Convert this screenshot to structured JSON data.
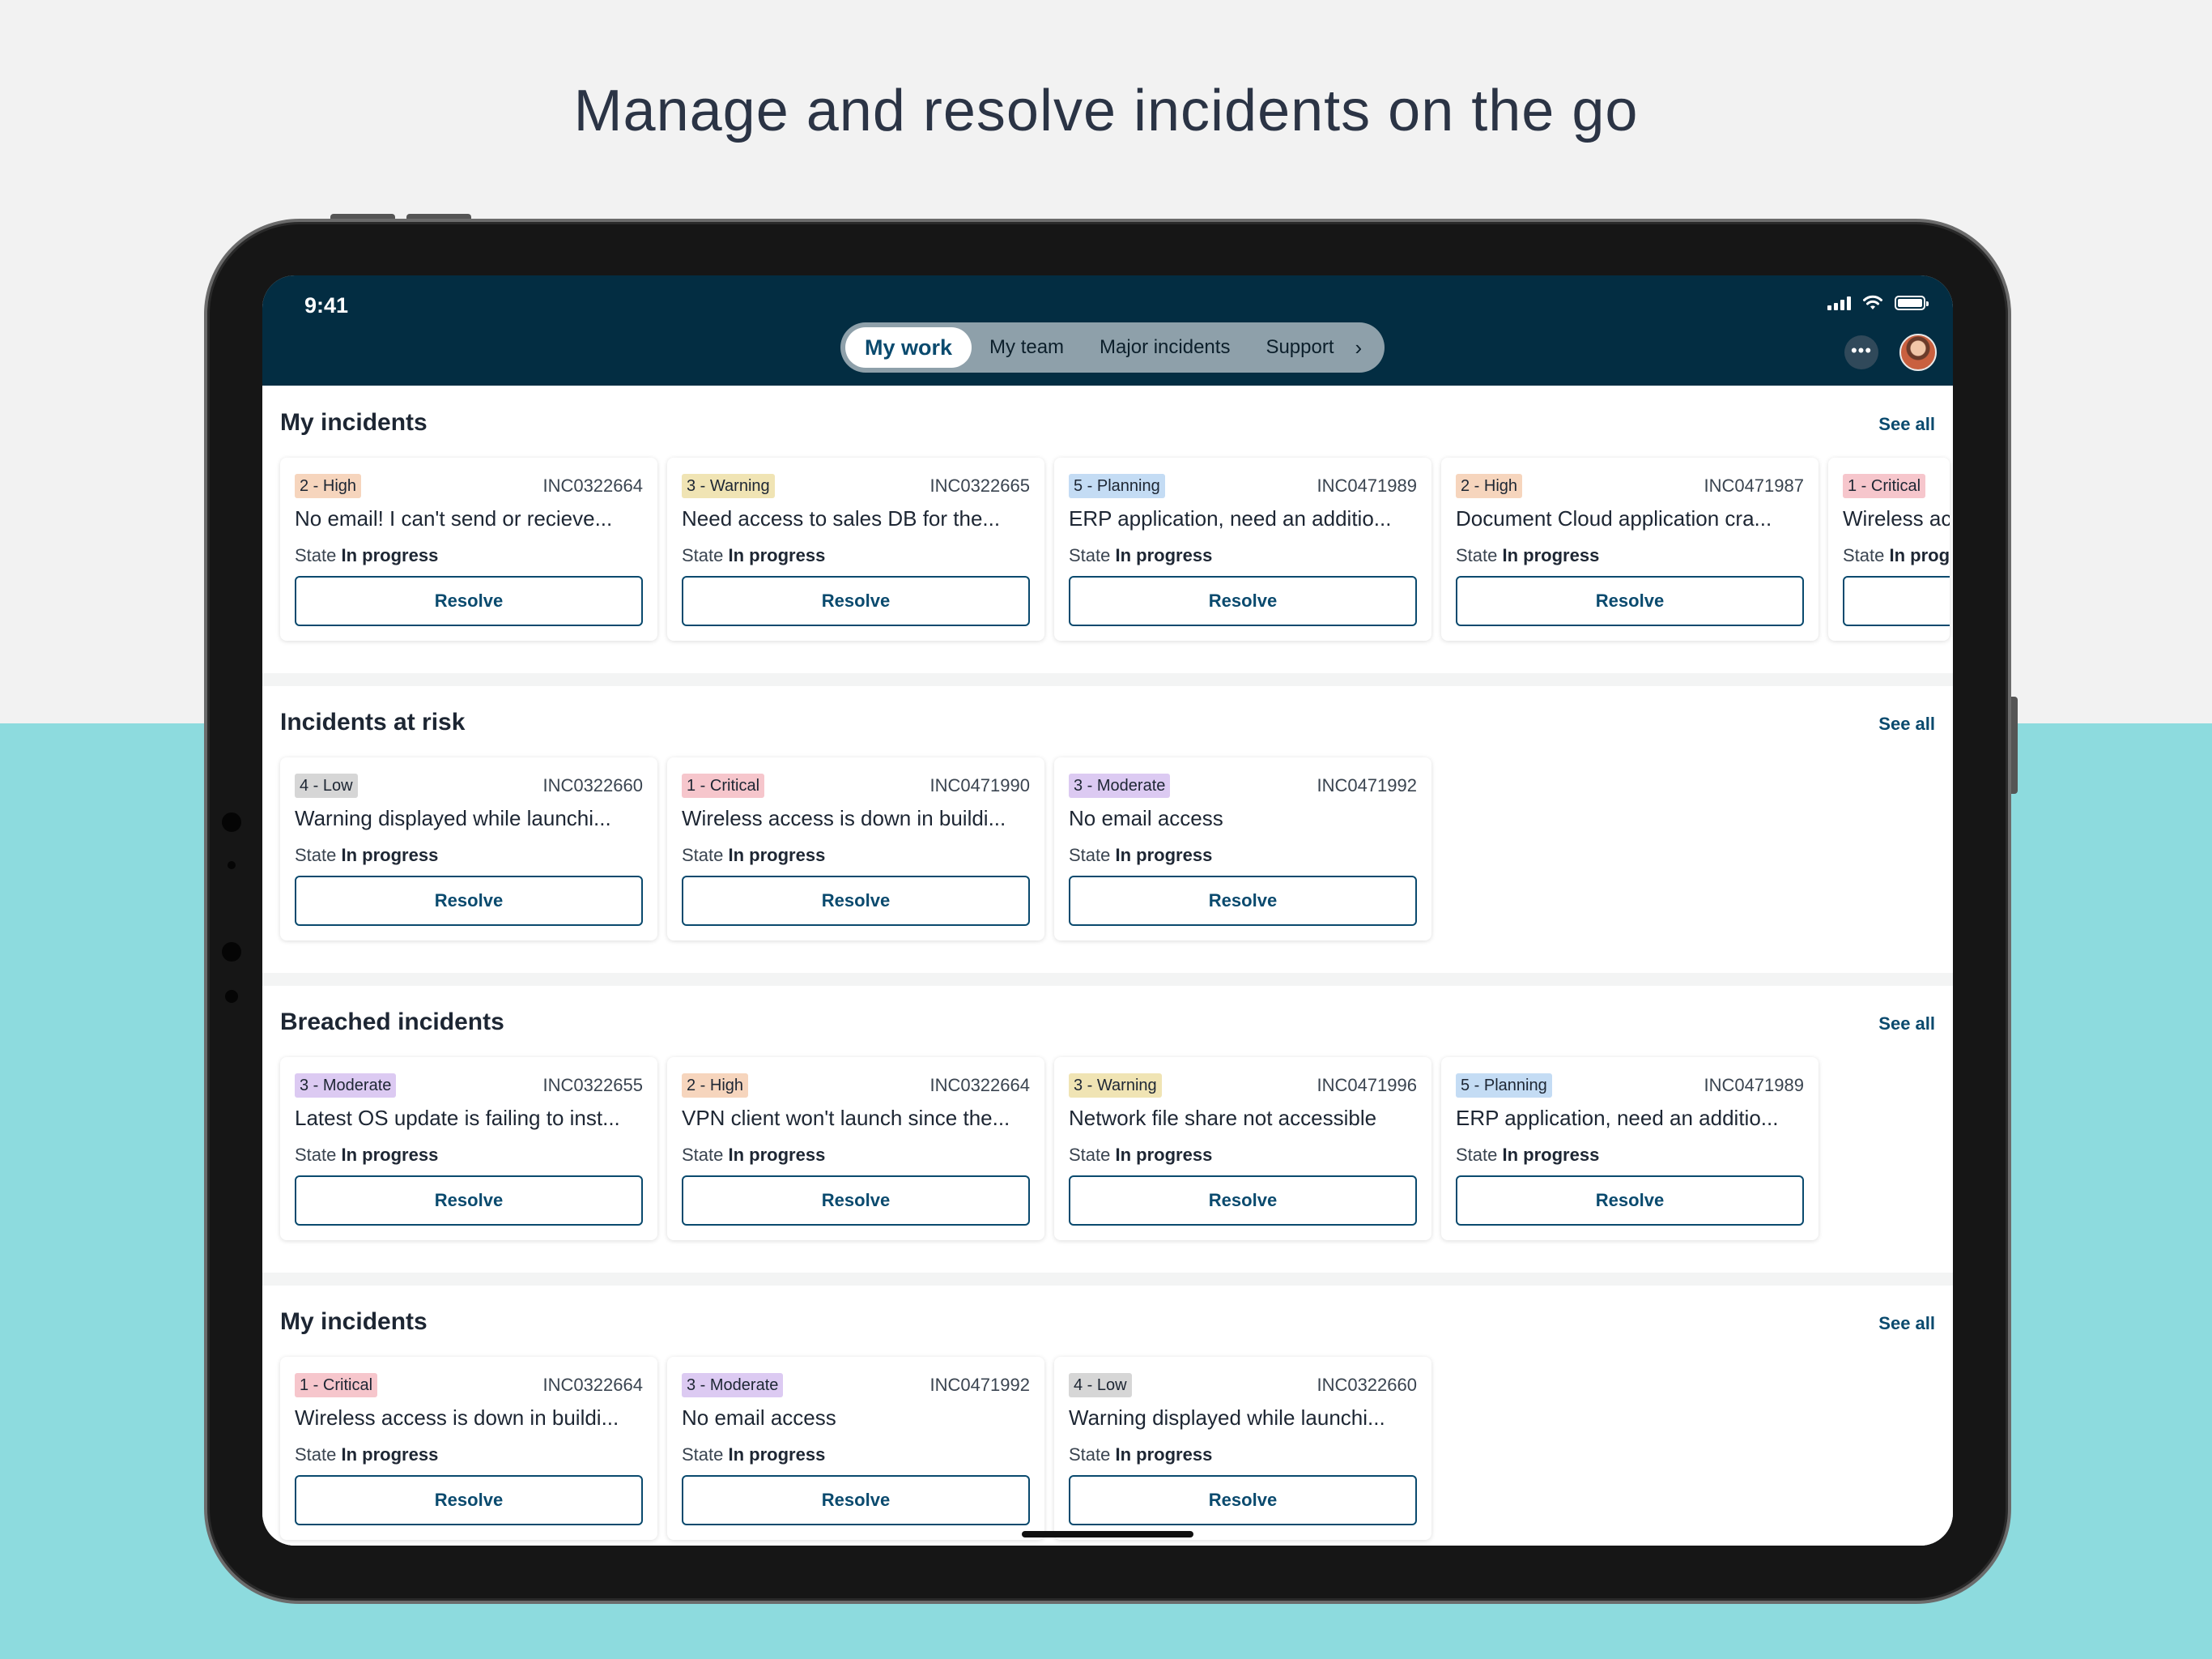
{
  "headline": "Manage and resolve incidents on the go",
  "status_bar": {
    "time": "9:41"
  },
  "nav": {
    "tabs": [
      {
        "label": "My work",
        "active": true
      },
      {
        "label": "My team",
        "active": false
      },
      {
        "label": "Major incidents",
        "active": false
      },
      {
        "label": "Support",
        "active": false
      }
    ],
    "more_icon": "more-icon",
    "chevron_icon": "chevron-right-icon",
    "avatar_icon": "user-avatar"
  },
  "colors": {
    "header": "#032d42",
    "accent": "#0a4a6e",
    "priority": {
      "critical": "#f6c6cc",
      "high": "#f6d5bd",
      "warning": "#f0e4b4",
      "moderate": "#dccaf2",
      "planning": "#c4dcf4",
      "low": "#d6d6d6"
    }
  },
  "common": {
    "state_label": "State",
    "state_value": "In progress",
    "resolve_label": "Resolve",
    "see_all": "See all"
  },
  "sections": [
    {
      "title": "My incidents",
      "cards": [
        {
          "priority": "2 - High",
          "color": "#f6d5bd",
          "number": "INC0322664",
          "title": "No email! I can't send or recieve..."
        },
        {
          "priority": "3 - Warning",
          "color": "#f0e4b4",
          "number": "INC0322665",
          "title": "Need access to sales DB for the..."
        },
        {
          "priority": "5 - Planning",
          "color": "#c4dcf4",
          "number": "INC0471989",
          "title": "ERP application, need an additio..."
        },
        {
          "priority": "2 - High",
          "color": "#f6d5bd",
          "number": "INC0471987",
          "title": "Document Cloud application cra..."
        },
        {
          "priority": "1 - Critical",
          "color": "#f6c6cc",
          "number": "",
          "title": "Wireless ac",
          "state_value": "In prog",
          "partial": true
        }
      ]
    },
    {
      "title": "Incidents at risk",
      "cards": [
        {
          "priority": "4 - Low",
          "color": "#d6d6d6",
          "number": "INC0322660",
          "title": "Warning displayed while launchi..."
        },
        {
          "priority": "1 - Critical",
          "color": "#f6c6cc",
          "number": "INC0471990",
          "title": "Wireless access is down in buildi..."
        },
        {
          "priority": "3 - Moderate",
          "color": "#dccaf2",
          "number": "INC0471992",
          "title": "No email access"
        }
      ]
    },
    {
      "title": "Breached incidents",
      "cards": [
        {
          "priority": "3 - Moderate",
          "color": "#dccaf2",
          "number": "INC0322655",
          "title": "Latest OS update is failing to inst..."
        },
        {
          "priority": "2 - High",
          "color": "#f6d5bd",
          "number": "INC0322664",
          "title": "VPN client won't launch since the..."
        },
        {
          "priority": "3 - Warning",
          "color": "#f0e4b4",
          "number": "INC0471996",
          "title": "Network file share not accessible"
        },
        {
          "priority": "5 - Planning",
          "color": "#c4dcf4",
          "number": "INC0471989",
          "title": "ERP application, need an additio..."
        }
      ]
    },
    {
      "title": "My incidents",
      "cards": [
        {
          "priority": "1 - Critical",
          "color": "#f6c6cc",
          "number": "INC0322664",
          "title": "Wireless access is down in buildi..."
        },
        {
          "priority": "3 - Moderate",
          "color": "#dccaf2",
          "number": "INC0471992",
          "title": "No email access"
        },
        {
          "priority": "4 - Low",
          "color": "#d6d6d6",
          "number": "INC0322660",
          "title": "Warning displayed while launchi..."
        }
      ]
    }
  ]
}
